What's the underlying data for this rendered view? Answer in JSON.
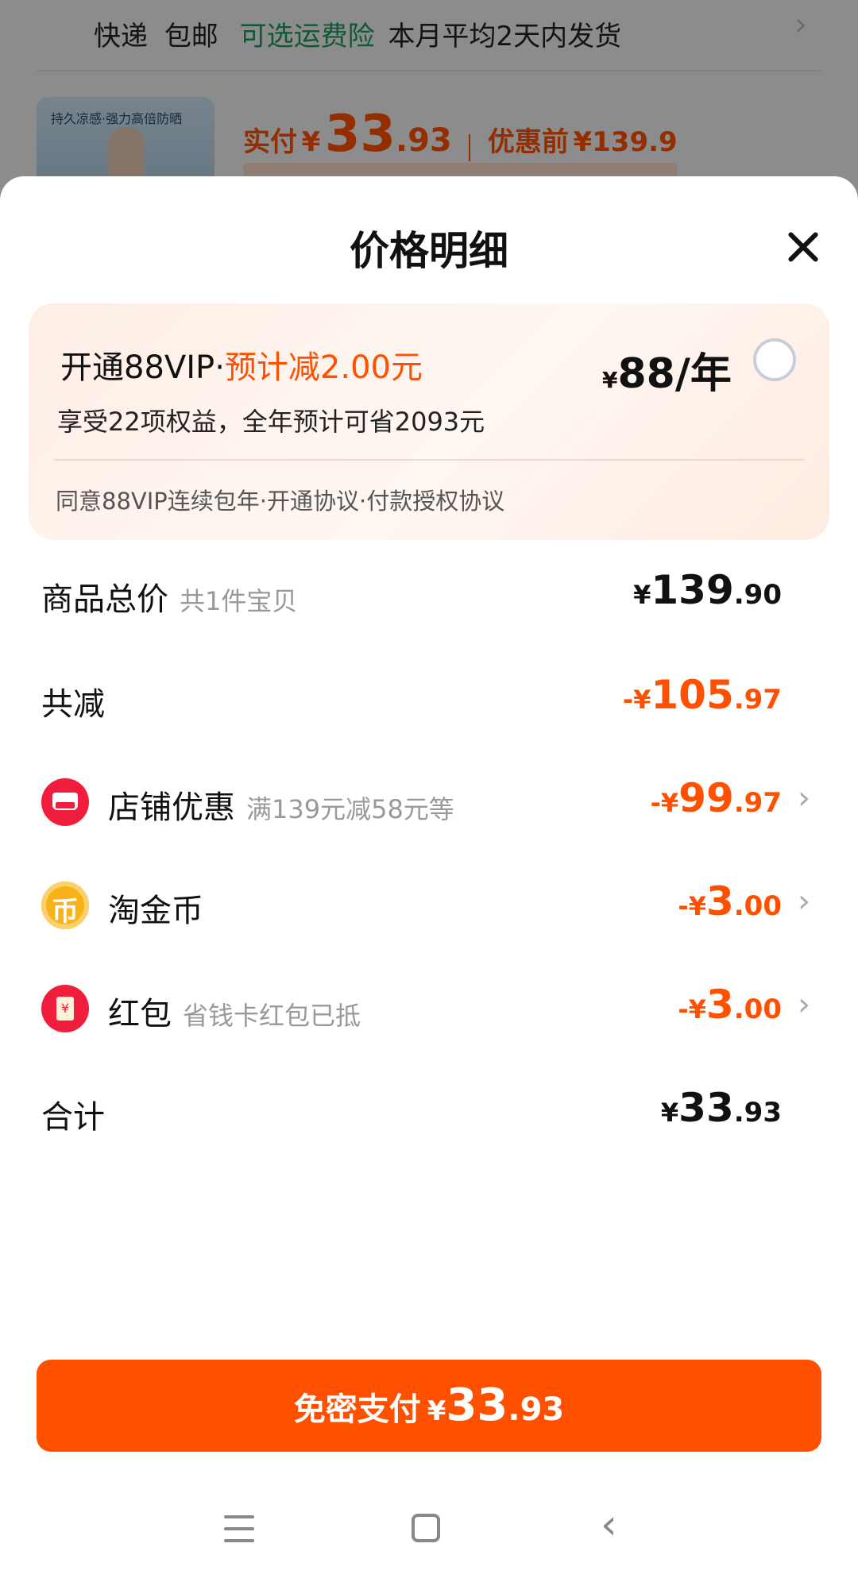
{
  "background": {
    "shipping": {
      "method": "快递",
      "free": "包邮",
      "insurance": "可选运费险",
      "delivery": "本月平均2天内发货"
    },
    "product_image_text": "持久凉感·强力高倍防晒",
    "price": {
      "paid_label": "实付",
      "currency": "¥",
      "integer": "33",
      "decimal": ".93",
      "before_label": "优惠前",
      "before_value": "¥139.9"
    }
  },
  "sheet": {
    "title": "价格明细",
    "vip": {
      "title": "开通88VIP",
      "dot": "·",
      "discount": "预计减2.00元",
      "benefits": "享受22项权益，全年预计可省2093元",
      "price_currency": "¥",
      "price": "88/年",
      "selected": false,
      "agreement": "同意88VIP连续包年·开通协议·付款授权协议"
    },
    "rows": [
      {
        "label": "商品总价",
        "sub": "共1件宝贝",
        "currency": "¥",
        "int": "139",
        "dec": ".90",
        "color": "#111111",
        "icon": null
      },
      {
        "label": "共减",
        "sub": "",
        "currency": "-¥",
        "int": "105",
        "dec": ".97",
        "color": "#ff5000",
        "icon": null
      },
      {
        "label": "店铺优惠",
        "sub": "满139元减58元等",
        "currency": "-¥",
        "int": "99",
        "dec": ".97",
        "color": "#ff5000",
        "icon": "shop-icon"
      },
      {
        "label": "淘金币",
        "sub": "",
        "currency": "-¥",
        "int": "3",
        "dec": ".00",
        "color": "#ff5000",
        "icon": "coin-icon",
        "icon_glyph": "币"
      },
      {
        "label": "红包",
        "sub": "省钱卡红包已抵",
        "currency": "-¥",
        "int": "3",
        "dec": ".00",
        "color": "#ff5000",
        "icon": "red-packet-icon",
        "icon_glyph": "¥"
      },
      {
        "label": "合计",
        "sub": "",
        "currency": "¥",
        "int": "33",
        "dec": ".93",
        "color": "#111111",
        "icon": null
      }
    ],
    "pay_button": {
      "label": "免密支付",
      "currency": "¥",
      "int": "33",
      "dec": ".93"
    }
  },
  "colors": {
    "accent": "#ff5000",
    "shop_red": "#f01d3c",
    "coin_gold": "#f8b21a",
    "insurance_green": "#1d9a5a"
  }
}
